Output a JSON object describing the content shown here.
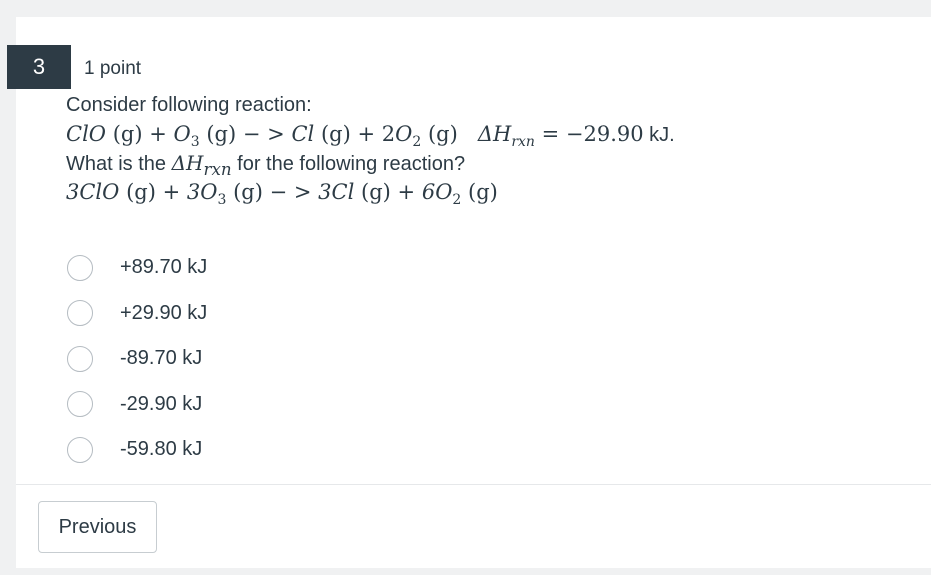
{
  "question": {
    "number": "3",
    "points": "1 point",
    "intro": "Consider following reaction:",
    "reaction1": {
      "lhs_a": "ClO",
      "lhs_a_state": "(g)",
      "plus1": "+",
      "lhs_b": "O",
      "lhs_b_sub": "3",
      "lhs_b_state": "(g)",
      "arrow": "− >",
      "rhs_a": "Cl",
      "rhs_a_state": "(g)",
      "plus2": "+",
      "rhs_b_coef": "2",
      "rhs_b": "O",
      "rhs_b_sub": "2",
      "rhs_b_state": "(g)",
      "delta": "ΔH",
      "delta_sub": "rxn",
      "equals": "= −29.90",
      "unit": " kJ."
    },
    "prompt_before": "What is the ",
    "prompt_delta": "ΔH",
    "prompt_delta_sub": "rxn",
    "prompt_after": " for the following reaction?",
    "reaction2": {
      "lhs_a": "3ClO",
      "lhs_a_state": "(g)",
      "plus1": "+",
      "lhs_b": "3O",
      "lhs_b_sub": "3",
      "lhs_b_state": "(g)",
      "arrow": "− >",
      "rhs_a": "3Cl",
      "rhs_a_state": "(g)",
      "plus2": "+",
      "rhs_b": "6O",
      "rhs_b_sub": "2",
      "rhs_b_state": "(g)"
    }
  },
  "answers": [
    {
      "label": "+89.70 kJ"
    },
    {
      "label": "+29.90 kJ"
    },
    {
      "label": "-89.70 kJ"
    },
    {
      "label": "-29.90 kJ"
    },
    {
      "label": "-59.80 kJ"
    }
  ],
  "navigation": {
    "previous_label": "Previous"
  }
}
